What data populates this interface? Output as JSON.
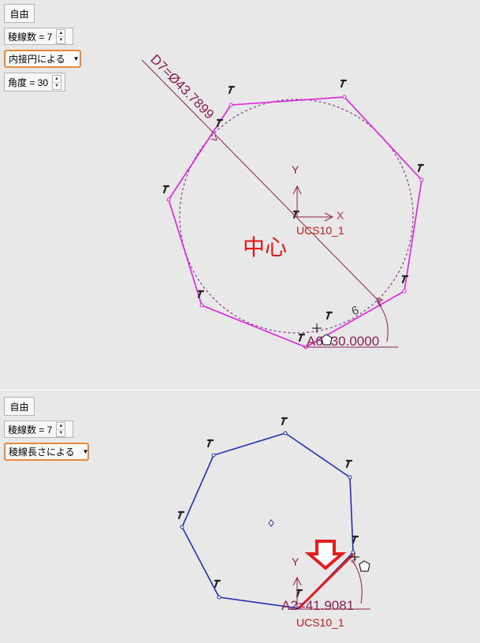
{
  "top": {
    "mode_button": "自由",
    "edge_count": "稜線数 = 7",
    "method_dropdown": "内接円による",
    "angle_field": "角度 = 30",
    "diameter_dim": "D7=Ø43.7899",
    "angle_dim": "A6=30.0000",
    "center_label": "中心",
    "ucs_label": "UCS10_1",
    "axis_y": "Y",
    "axis_x": "X",
    "dim_index": "6"
  },
  "bottom": {
    "mode_button": "自由",
    "edge_count": "稜線数 = 7",
    "method_dropdown": "稜線長さによる",
    "length_dim": "A2=41.9081",
    "ucs_label": "UCS10_1",
    "axis_y": "Y"
  },
  "colors": {
    "top_polygon": "#dd22dd",
    "dimension": "#8a1e4f",
    "bottom_polygon": "#1f2fb0",
    "highlight": "#e02020",
    "dropdown_border": "#e9873a"
  }
}
